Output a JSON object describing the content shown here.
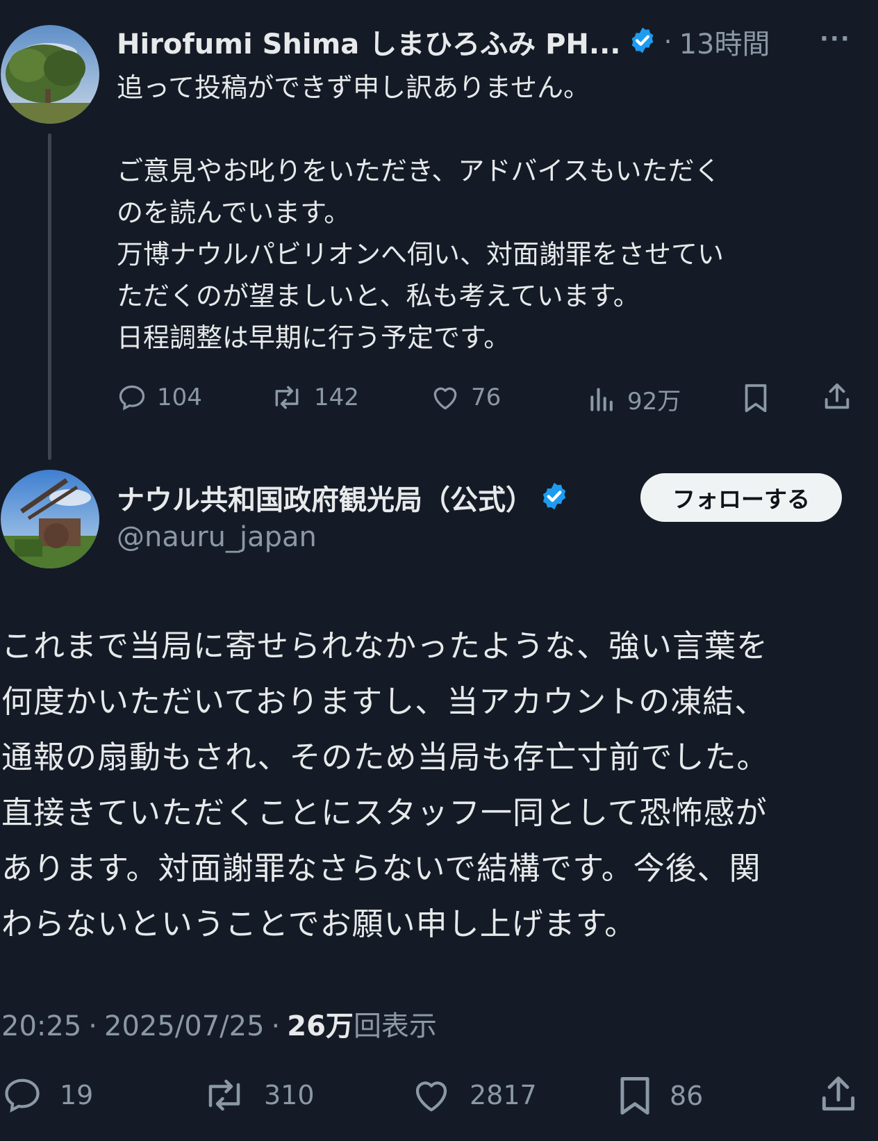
{
  "tweet1": {
    "display_name": "Hirofumi Shima しまひろふみ PH...",
    "separator": "·",
    "time": "13時間",
    "more": "···",
    "body": "追って投稿ができず申し訳ありません。\n\nご意見やお叱りをいただき、アドバイスもいただく\nのを読んでいます。\n万博ナウルパビリオンへ伺い、対面謝罪をさせてい\nただくのが望ましいと、私も考えています。\n日程調整は早期に行う予定です。",
    "stats": {
      "replies": "104",
      "retweets": "142",
      "likes": "76",
      "views": "92万"
    }
  },
  "tweet2": {
    "display_name": "ナウル共和国政府観光局（公式）",
    "handle": "@nauru_japan",
    "follow_label": "フォローする",
    "body": "これまで当局に寄せられなかったような、強い言葉を\n何度かいただいておりますし、当アカウントの凍結、\n通報の扇動もされ、そのため当局も存亡寸前でした。\n直接きていただくことにスタッフ一同として恐怖感が\nあります。対面謝罪なさらないで結構です。今後、関\nわらないということでお願い申し上げます。",
    "meta": {
      "time": "20:25",
      "sep1": "·",
      "date": "2025/07/25",
      "sep2": "·",
      "views_count": "26万",
      "views_label": "回表示"
    },
    "stats": {
      "replies": "19",
      "retweets": "310",
      "likes": "2817",
      "bookmarks": "86"
    }
  },
  "colors": {
    "background": "#141b26",
    "text": "#e7e9ea",
    "muted": "#8b98a5",
    "verified": "#1d9bf0"
  }
}
